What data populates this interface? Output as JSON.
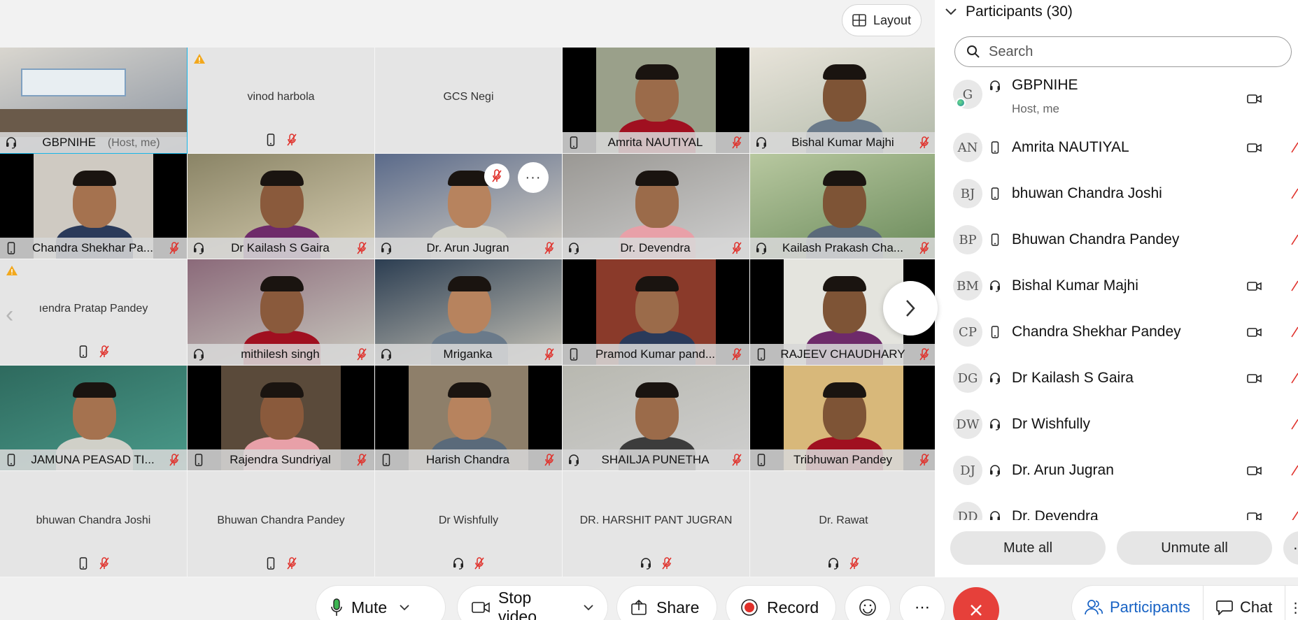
{
  "layout_button": {
    "label": "Layout",
    "icon": "layout-grid-icon"
  },
  "tiles": [
    {
      "name": "GBPNIHE",
      "sub": "(Host, me)",
      "video": true,
      "active": true
    },
    {
      "name": "vinod harbola",
      "video": false,
      "warning": true
    },
    {
      "name": "GCS Negi",
      "video": false
    },
    {
      "name": "Amrita NAUTIYAL",
      "video": true
    },
    {
      "name": "Bishal Kumar Majhi",
      "video": true
    },
    {
      "name": "Chandra Shekhar Pa...",
      "video": true
    },
    {
      "name": "Dr Kailash S Gaira",
      "video": true
    },
    {
      "name": "Dr. Arun Jugran",
      "video": true
    },
    {
      "name": "Dr. Devendra",
      "video": true
    },
    {
      "name": "Kailash Prakash Cha...",
      "video": true
    },
    {
      "name": "ıendra Pratap Pandey",
      "video": false,
      "warning": true
    },
    {
      "name": "mithilesh singh",
      "video": true
    },
    {
      "name": "Mriganka",
      "video": true
    },
    {
      "name": "Pramod Kumar pand...",
      "video": true
    },
    {
      "name": "RAJEEV CHAUDHARY",
      "video": true
    },
    {
      "name": "JAMUNA PEASAD TI...",
      "video": true
    },
    {
      "name": "Rajendra Sundriyal",
      "video": true
    },
    {
      "name": "Harish Chandra",
      "video": true
    },
    {
      "name": "SHAILJA PUNETHA",
      "video": true
    },
    {
      "name": "Tribhuwan Pandey",
      "video": true
    },
    {
      "name": "bhuwan Chandra Joshi",
      "video": false
    },
    {
      "name": "Bhuwan Chandra Pandey",
      "video": false
    },
    {
      "name": "Dr Wishfully",
      "video": false
    },
    {
      "name": "DR. HARSHIT PANT JUGRAN",
      "video": false
    },
    {
      "name": "Dr. Rawat",
      "video": false
    }
  ],
  "panel": {
    "title": "Participants (30)",
    "search_placeholder": "Search",
    "participants": [
      {
        "initials": "G",
        "name": "GBPNIHE",
        "sub": "Host, me",
        "device": "headset",
        "camera": true
      },
      {
        "initials": "AN",
        "name": "Amrita NAUTIYAL",
        "device": "phone",
        "camera": true
      },
      {
        "initials": "BJ",
        "name": "bhuwan Chandra Joshi",
        "device": "phone",
        "camera": false
      },
      {
        "initials": "BP",
        "name": "Bhuwan Chandra Pandey",
        "device": "phone",
        "camera": false
      },
      {
        "initials": "BM",
        "name": "Bishal Kumar Majhi",
        "device": "headset",
        "camera": true
      },
      {
        "initials": "CP",
        "name": "Chandra Shekhar Pandey",
        "device": "phone",
        "camera": true
      },
      {
        "initials": "DG",
        "name": "Dr Kailash S Gaira",
        "device": "headset",
        "camera": true
      },
      {
        "initials": "DW",
        "name": "Dr Wishfully",
        "device": "headset",
        "camera": false
      },
      {
        "initials": "DJ",
        "name": "Dr. Arun Jugran",
        "device": "headset",
        "camera": true
      },
      {
        "initials": "DD",
        "name": "Dr. Devendra",
        "device": "headset",
        "camera": true
      }
    ],
    "mute_all": "Mute all",
    "unmute_all": "Unmute all",
    "more": "⋯"
  },
  "toolbar": {
    "mute": "Mute",
    "stop_video": "Stop video",
    "share": "Share",
    "record": "Record",
    "more": "⋯",
    "participants": "Participants",
    "chat": "Chat"
  },
  "colors": {
    "active_outline": "#18b6e8",
    "muted_red": "#e0302a",
    "end_call": "#e6403a",
    "tab_active": "#1762c4"
  }
}
